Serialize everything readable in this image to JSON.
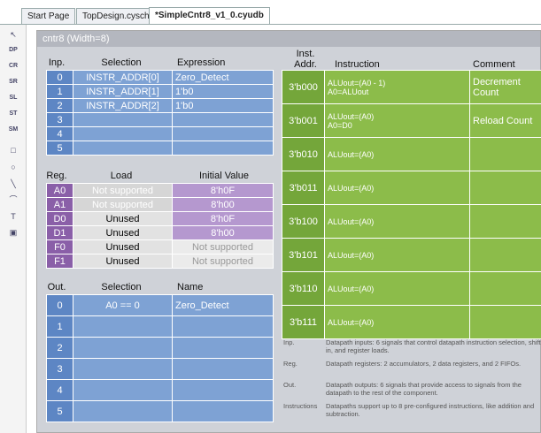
{
  "tabs": [
    "Start Page",
    "TopDesign.cysch",
    "*SimpleCntr8_v1_0.cyudb"
  ],
  "toolbar": {
    "tools": [
      {
        "name": "pointer",
        "glyph": "↖"
      },
      {
        "name": "dp",
        "glyph": "DP"
      },
      {
        "name": "cr",
        "glyph": "CR"
      },
      {
        "name": "sr",
        "glyph": "SR"
      },
      {
        "name": "sl",
        "glyph": "SL"
      },
      {
        "name": "st",
        "glyph": "ST"
      },
      {
        "name": "sm",
        "glyph": "SM"
      },
      {
        "name": "rectangle",
        "glyph": "□"
      },
      {
        "name": "ellipse",
        "glyph": "○"
      },
      {
        "name": "line",
        "glyph": "╲"
      },
      {
        "name": "arc",
        "glyph": "⌒"
      },
      {
        "name": "text",
        "glyph": "T"
      },
      {
        "name": "image",
        "glyph": "▣"
      }
    ]
  },
  "panel": {
    "title": "cntr8 (Width=8)"
  },
  "inputs": {
    "headers": [
      "Inp.",
      "Selection",
      "Expression"
    ],
    "rows": [
      {
        "num": "0",
        "sel": "INSTR_ADDR[0]",
        "expr": "Zero_Detect"
      },
      {
        "num": "1",
        "sel": "INSTR_ADDR[1]",
        "expr": "1'b0"
      },
      {
        "num": "2",
        "sel": "INSTR_ADDR[2]",
        "expr": "1'b0"
      },
      {
        "num": "3",
        "sel": "",
        "expr": ""
      },
      {
        "num": "4",
        "sel": "",
        "expr": ""
      },
      {
        "num": "5",
        "sel": "",
        "expr": ""
      }
    ]
  },
  "registers": {
    "headers": [
      "Reg.",
      "Load",
      "Initial Value"
    ],
    "rows": [
      {
        "num": "A0",
        "load": "Not supported",
        "init": "8'h0F"
      },
      {
        "num": "A1",
        "load": "Not supported",
        "init": "8'h00"
      },
      {
        "num": "D0",
        "load": "Unused",
        "init": "8'h0F"
      },
      {
        "num": "D1",
        "load": "Unused",
        "init": "8'h00"
      },
      {
        "num": "F0",
        "load": "Unused",
        "init": "Not supported"
      },
      {
        "num": "F1",
        "load": "Unused",
        "init": "Not supported"
      }
    ]
  },
  "outputs": {
    "headers": [
      "Out.",
      "Selection",
      "Name"
    ],
    "rows": [
      {
        "num": "0",
        "sel": "A0 == 0",
        "name": "Zero_Detect"
      },
      {
        "num": "1",
        "sel": "",
        "name": ""
      },
      {
        "num": "2",
        "sel": "",
        "name": ""
      },
      {
        "num": "3",
        "sel": "",
        "name": ""
      },
      {
        "num": "4",
        "sel": "",
        "name": ""
      },
      {
        "num": "5",
        "sel": "",
        "name": ""
      }
    ]
  },
  "instructions": {
    "headers": [
      "Inst.\nAddr.",
      "Instruction",
      "Comment"
    ],
    "rows": [
      {
        "addr": "3'b000",
        "instr": "ALUout=(A0 - 1)\nA0=ALUout",
        "comment": "Decrement Count"
      },
      {
        "addr": "3'b001",
        "instr": "ALUout=(A0)\nA0=D0",
        "comment": "Reload Count"
      },
      {
        "addr": "3'b010",
        "instr": "ALUout=(A0)",
        "comment": ""
      },
      {
        "addr": "3'b011",
        "instr": "ALUout=(A0)",
        "comment": ""
      },
      {
        "addr": "3'b100",
        "instr": "ALUout=(A0)",
        "comment": ""
      },
      {
        "addr": "3'b101",
        "instr": "ALUout=(A0)",
        "comment": ""
      },
      {
        "addr": "3'b110",
        "instr": "ALUout=(A0)",
        "comment": ""
      },
      {
        "addr": "3'b111",
        "instr": "ALUout=(A0)",
        "comment": ""
      }
    ]
  },
  "notes": [
    {
      "key": "Inp.",
      "text": "Datapath inputs: 6 signals that control datapath instruction selection, shift in, and register loads."
    },
    {
      "key": "Reg.",
      "text": "Datapath registers: 2 accumulators, 2 data registers, and 2 FIFOs."
    },
    {
      "key": "Out.",
      "text": "Datapath outputs: 6 signals that provide access to signals from the datapath to the rest of the component."
    },
    {
      "key": "Instructions",
      "text": "Datapaths support up to 8 pre-configured instructions, like addition and subtraction."
    }
  ]
}
